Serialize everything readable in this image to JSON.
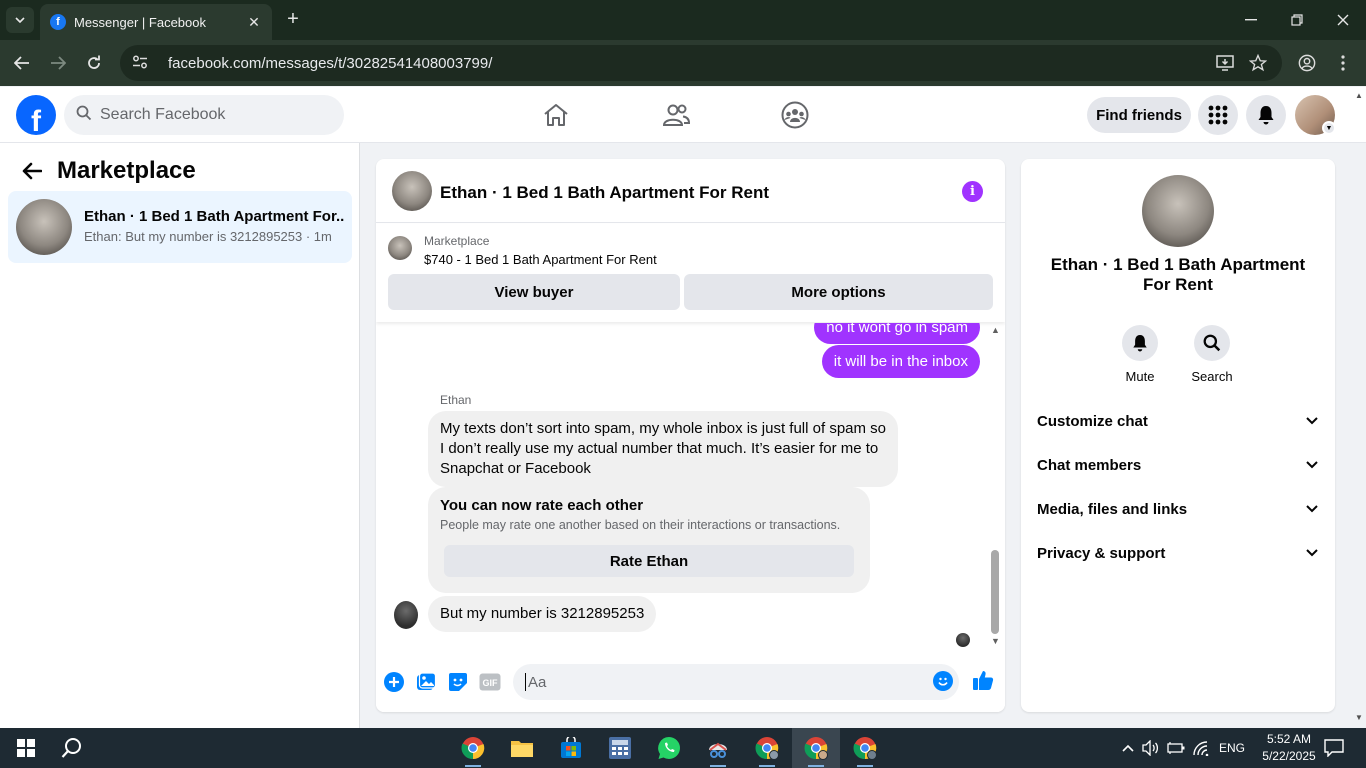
{
  "browser": {
    "tab_title": "Messenger | Facebook",
    "url": "facebook.com/messages/t/30282541408003799/",
    "tab_favicon_letter": "f"
  },
  "fb_nav": {
    "logo_letter": "f",
    "search_placeholder": "Search Facebook",
    "find_friends": "Find friends"
  },
  "sidebar": {
    "title": "Marketplace",
    "conversations": [
      {
        "title": "Ethan · 1 Bed 1 Bath Apartment For...",
        "preview": "Ethan: But my number is 3212895253 · 1m"
      }
    ]
  },
  "chat": {
    "title": "Ethan · 1 Bed 1 Bath Apartment For Rent",
    "info_glyph": "i",
    "marketplace_label": "Marketplace",
    "listing": "$740 - 1 Bed 1 Bath Apartment For Rent",
    "view_buyer": "View buyer",
    "more_options": "More options",
    "outgoing": [
      "no it wont go in spam",
      "it will be in the inbox"
    ],
    "sender_name": "Ethan",
    "incoming_long": "My texts don’t sort into spam, my whole inbox is just full of spam so I don’t really use my actual number that much. It’s easier for me to Snapchat or Facebook",
    "rate_title": "You can now rate each other",
    "rate_subtitle": "People may rate one another based on their interactions or transactions.",
    "rate_button": "Rate Ethan",
    "incoming_last": "But my number is 3212895253",
    "composer_placeholder": "Aa",
    "gif_label": "GIF"
  },
  "info_panel": {
    "title": "Ethan · 1 Bed 1 Bath Apartment For Rent",
    "mute": "Mute",
    "search": "Search",
    "sections": [
      "Customize chat",
      "Chat members",
      "Media, files and links",
      "Privacy & support"
    ]
  },
  "taskbar": {
    "language": "ENG",
    "time": "5:52 AM",
    "date": "5/22/2025"
  },
  "colors": {
    "accent_purple": "#a033ff",
    "fb_blue": "#0866ff",
    "messenger_blue": "#0084ff"
  }
}
